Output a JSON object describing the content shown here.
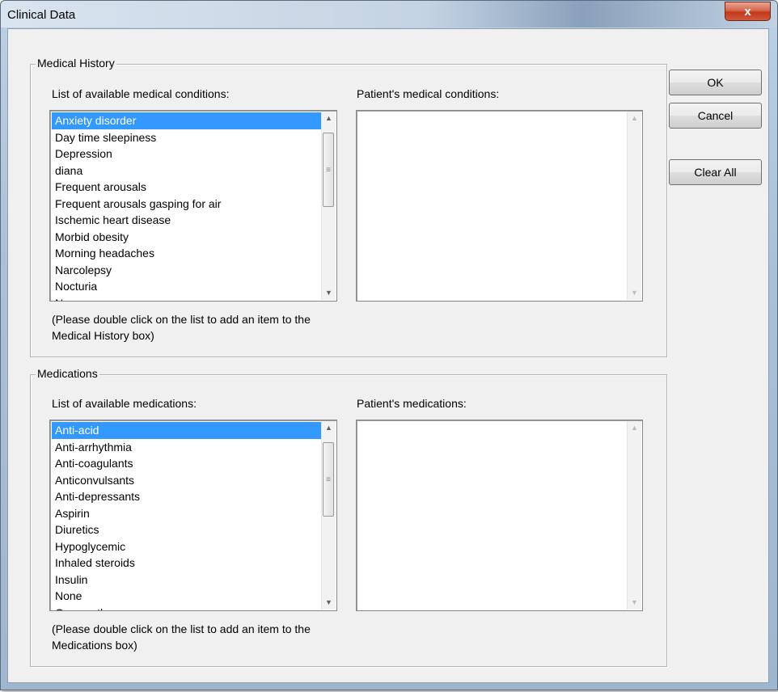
{
  "window": {
    "title": "Clinical Data",
    "close_glyph": "x"
  },
  "buttons": {
    "ok": "OK",
    "cancel": "Cancel",
    "clear_all": "Clear All"
  },
  "medical_history": {
    "legend": "Medical History",
    "available_label": "List of available medical conditions:",
    "patient_label": "Patient's medical conditions:",
    "available_items": [
      "Anxiety disorder",
      "Day time sleepiness",
      "Depression",
      "diana",
      "Frequent arousals",
      "Frequent arousals gasping for air",
      "Ischemic heart disease",
      "Morbid obesity",
      "Morning headaches",
      "Narcolepsy",
      "Nocturia",
      "None"
    ],
    "selected_index": 0,
    "note_line1": "(Please double click on the list to add an item to the",
    "note_line2": "Medical History box)"
  },
  "medications": {
    "legend": "Medications",
    "available_label": "List of available medications:",
    "patient_label": "Patient's medications:",
    "available_items": [
      "Anti-acid",
      "Anti-arrhythmia",
      "Anti-coagulants",
      "Anticonvulsants",
      "Anti-depressants",
      "Aspirin",
      "Diuretics",
      "Hypoglycemic",
      "Inhaled steroids",
      "Insulin",
      "None",
      "Oxygen therapy"
    ],
    "selected_index": 0,
    "note_line1": "(Please double click on the list to add an item to the",
    "note_line2": "Medications box)"
  },
  "icons": {
    "scroll_up": "up-arrow-icon",
    "scroll_down": "down-arrow-icon",
    "close": "close-icon"
  },
  "colors": {
    "selection": "#3399ff",
    "close_button": "#c2381c"
  }
}
